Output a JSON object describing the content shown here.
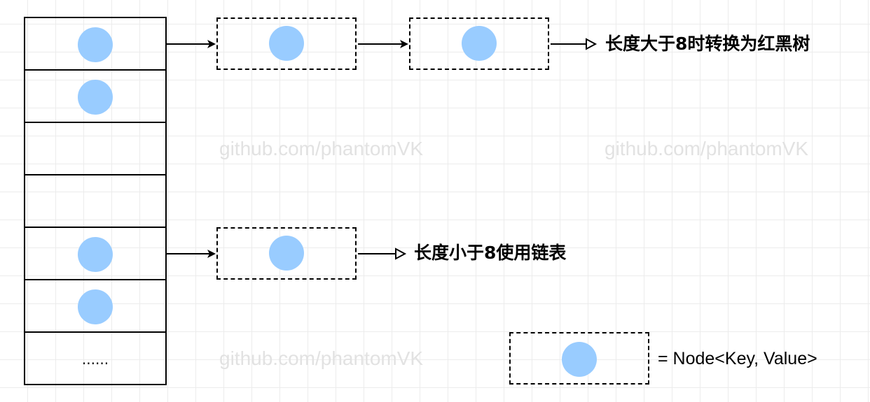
{
  "watermark_text": "github.com/phantomVK",
  "buckets": [
    {
      "has_node": true
    },
    {
      "has_node": true
    },
    {
      "has_node": false
    },
    {
      "has_node": false
    },
    {
      "has_node": true
    },
    {
      "has_node": true
    },
    {
      "has_node": false,
      "text": "......"
    }
  ],
  "labels": {
    "tree_note": "长度大于8时转换为红黑树",
    "list_note": "长度小于8使用链表"
  },
  "legend": {
    "text": "= Node<Key, Value>"
  },
  "colors": {
    "node_fill": "#99ccff",
    "watermark": "#e2e2e2"
  }
}
